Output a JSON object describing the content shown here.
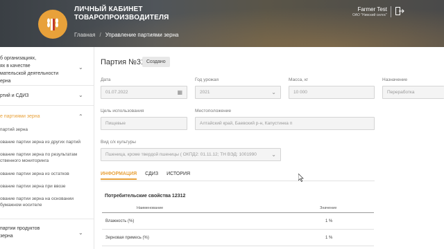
{
  "header": {
    "brand_line1": "ЛИЧНЫЙ КАБИНЕТ",
    "brand_line2": "ТОВАРОПРОИЗВОДИТЕЛЯ",
    "breadcrumb": {
      "home": "Главная",
      "separator": "/",
      "current": "Управление партиями зерна"
    },
    "user": {
      "name": "Farmer Test",
      "org": "ОАО \"Нивский силос\""
    },
    "logout_icon": "logout-icon"
  },
  "sidebar": {
    "section1": {
      "line1": "б организациях,",
      "line2": "ях в качестве",
      "line3": "мательской деятельности",
      "line4": "ерна"
    },
    "section2": {
      "label": "ртий и СДИЗ"
    },
    "section3": {
      "label": "е партиями зерна",
      "items": [
        "партий зерна",
        "ование партии зерна из других партий",
        "ование партии зерна по результатам",
        "ственного мониторинга",
        "ование партии зерна из остатков",
        "ование партии зерна при ввозе",
        "ование партии зерна на основании",
        "бумажном носителе"
      ]
    },
    "section4": {
      "line1": "партии продуктов",
      "line2": "зерна"
    },
    "colors": {
      "accent": "#e8a13a"
    }
  },
  "main": {
    "title": "Партия №31",
    "status": "Создано",
    "fields": {
      "date": {
        "label": "Дата",
        "value": "01.07.2022"
      },
      "year": {
        "label": "Год урожая",
        "value": "2021"
      },
      "mass": {
        "label": "Масса, кг",
        "value": "10 000"
      },
      "purpose": {
        "label": "Назначение",
        "value": "Переработка"
      },
      "use": {
        "label": "Цель использования",
        "value": "Пищевые"
      },
      "location": {
        "label": "Местоположение",
        "value": "Алтайский край, Баевский р-н, Капустинка п"
      },
      "crop": {
        "label": "Вид с/х культуры",
        "value": "Пшеница, кроме твердой пшеницы ( ОКПД2: 01.11.12; ТН ВЭД: 1001990"
      }
    },
    "tabs": [
      "ИНФОРМАЦИЯ",
      "СДИЗ",
      "ИСТОРИЯ"
    ],
    "properties": {
      "title": "Потребительские свойства 12312",
      "col_name": "Наименование",
      "col_value": "Значение",
      "rows": [
        {
          "name": "Влажность (%)",
          "value": "1 %"
        },
        {
          "name": "Зерновая примесь (%)",
          "value": "1 %"
        }
      ]
    }
  }
}
